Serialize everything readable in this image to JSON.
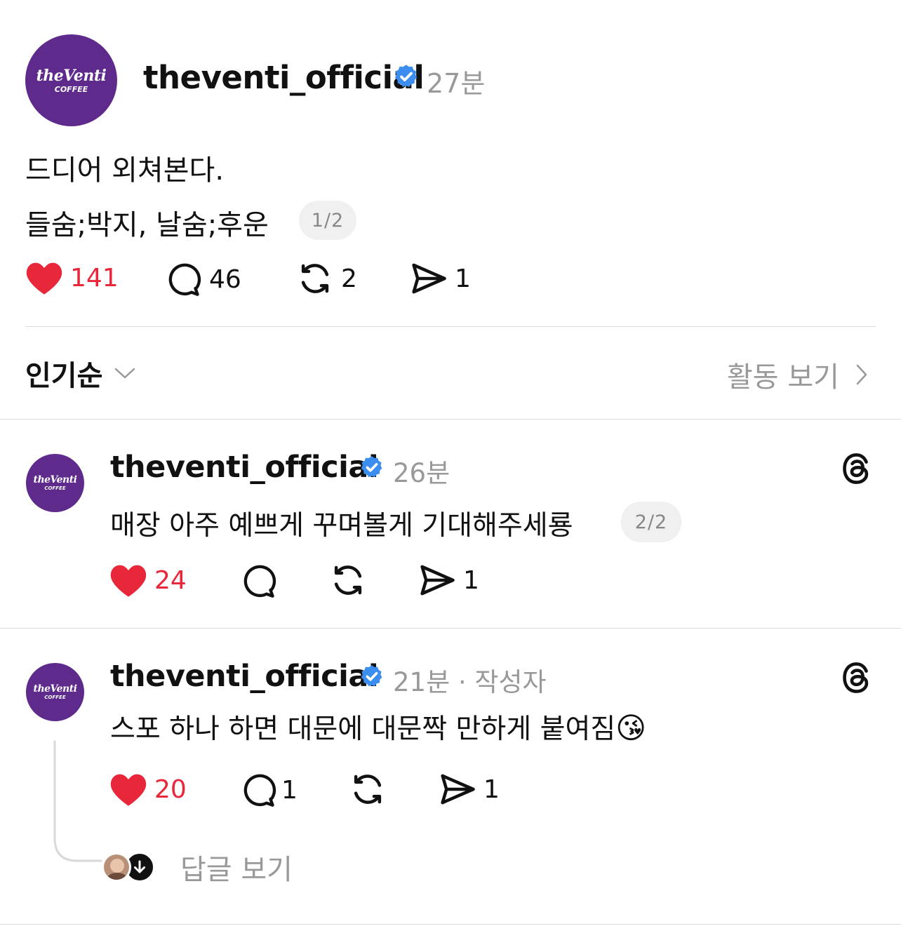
{
  "post": {
    "username": "theventi_official",
    "time": "27분",
    "lines": [
      "드디어 외쳐본다.",
      "들숨;박지,  날숨;후운"
    ],
    "pager": "1/2",
    "likes": "141",
    "comments": "46",
    "reposts": "2",
    "shares": "1"
  },
  "avatar_logo": {
    "main": "theVenti",
    "sub": "COFFEE"
  },
  "sort": {
    "label": "인기순",
    "activity_label": "활동 보기"
  },
  "replies": [
    {
      "username": "theventi_official",
      "time": "26분",
      "text": "매장 아주 예쁘게 꾸며볼게 기대해주세룡",
      "pager": "2/2",
      "likes": "24",
      "comments": "",
      "reposts": "",
      "shares": "1"
    },
    {
      "username": "theventi_official",
      "time": "21분 · 작성자",
      "text": "스포 하나 하면 대문에 대문짝 만하게 붙여짐",
      "emoji": "😘",
      "likes": "20",
      "comments": "1",
      "reposts": "",
      "shares": "1",
      "view_replies_label": "답글 보기"
    }
  ],
  "colors": {
    "like_red": "#e8273b",
    "verified_blue": "#3b8df0",
    "brand_purple": "#5e2a8c"
  },
  "icons": [
    "heart-icon",
    "comment-icon",
    "repost-icon",
    "share-icon",
    "threads-icon",
    "verified-icon",
    "chevron-down-icon",
    "chevron-right-icon",
    "arrow-down-icon"
  ]
}
